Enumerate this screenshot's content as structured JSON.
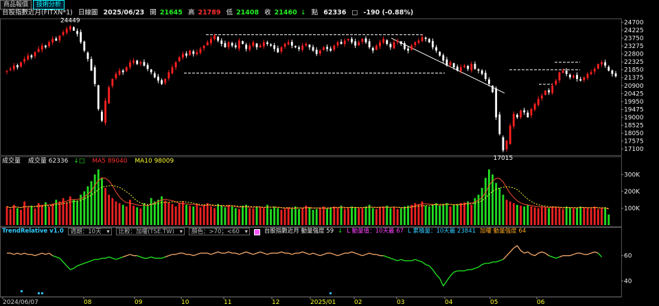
{
  "tabs": [
    {
      "label": "商品報價",
      "active": false
    },
    {
      "label": "技術分析",
      "active": true
    }
  ],
  "header": {
    "symbol": "台股指數近月(FITXN*1)",
    "period": "日線圖",
    "date": "2025/06/23",
    "open_label": "開",
    "open": "21645",
    "high_label": "高",
    "high": "21789",
    "low_label": "低",
    "low": "21408",
    "close": "21460",
    "down_arrow": "↓",
    "close_unit": "點",
    "volume": "62336",
    "box": "□",
    "change": "-190 (-0.88%)"
  },
  "volume_legend": {
    "title": "成交量",
    "vol_label": "成交量 62336",
    "ma5_label": "MA5 89040",
    "ma10_label": "MA10 98009",
    "marks": "↓□"
  },
  "indicator_legend": {
    "name": "TrendRelative v1.0",
    "period_sel": "週期：10天",
    "compare_sel": "比較：加權(TSE.TW)",
    "color_sel": "顏色：>70；<60",
    "ref_label": "台股指數近月 動量強度 59",
    "ref_mark": "↓",
    "l_momentum": "L 動量值：10天最 67",
    "l_accum": "L 累積量：10天最 23841",
    "weighted_mom": "加權 動量強度 64"
  },
  "colors": {
    "up": "#ff2020",
    "down": "#ffffff",
    "vol_up": "#ee2222",
    "vol_down": "#22dd22",
    "ma": "#ffb060",
    "ma10": "#ffff33",
    "trend_up": "#ffb070",
    "trend_down": "#22ee22"
  },
  "chart_data": [
    {
      "type": "candlestick",
      "title": "台股指數近月(FITXN*1) 日線圖",
      "x_tick_labels": [
        "2024/06/07",
        "08",
        "09",
        "10",
        "11",
        "12",
        "2025/01",
        "02",
        "03",
        "04",
        "05",
        "06"
      ],
      "y_tick_labels": [
        "24700",
        "24225",
        "23750",
        "23275",
        "22800",
        "22325",
        "21850",
        "21375",
        "20900",
        "20425",
        "19950",
        "19475",
        "19000",
        "18525",
        "18050",
        "17575",
        "17100"
      ],
      "ylim": [
        16900,
        24800
      ],
      "annotations": [
        {
          "text": "24449",
          "value": 24449
        },
        {
          "text": "17015",
          "value": 17015
        }
      ],
      "trendlines": [
        {
          "from": [
            "2024/11",
            "23950"
          ],
          "to": [
            "2025/03",
            "23950"
          ],
          "style": "dashed"
        },
        {
          "from": [
            "2024/10",
            "21650"
          ],
          "to": [
            "2025/04",
            "21650"
          ],
          "style": "dashed"
        },
        {
          "from": [
            "2025/03",
            "23750"
          ],
          "to": [
            "2025/05",
            "20450"
          ],
          "style": "solid"
        },
        {
          "from": [
            "2025/05",
            "21850"
          ],
          "to": [
            "2025/06",
            "21850"
          ],
          "style": "dashed"
        },
        {
          "from": [
            "2025/06",
            "20980"
          ],
          "to": [
            "2025/06",
            "20980"
          ],
          "style": "dashed"
        },
        {
          "from": [
            "2025/06",
            "22300"
          ],
          "to": [
            "2025/06",
            "22300"
          ],
          "style": "dashed"
        }
      ],
      "closes": [
        21800,
        21900,
        22100,
        22000,
        22300,
        22500,
        22700,
        22600,
        22900,
        23100,
        23300,
        23200,
        23500,
        23700,
        23600,
        23900,
        24100,
        24300,
        24449,
        24200,
        24000,
        23500,
        23000,
        22500,
        21800,
        21000,
        19500,
        18800,
        20000,
        20800,
        21300,
        21600,
        21800,
        21700,
        22000,
        22300,
        22400,
        22200,
        22300,
        22100,
        21900,
        21700,
        21400,
        21200,
        21000,
        21300,
        21700,
        22000,
        22300,
        22600,
        22800,
        22700,
        23000,
        22800,
        22900,
        23100,
        23300,
        23500,
        23700,
        23900,
        23600,
        23400,
        23200,
        23500,
        23300,
        23200,
        23600,
        23400,
        23100,
        23300,
        23500,
        23200,
        23300,
        23500,
        23400,
        23300,
        23100,
        22900,
        23200,
        23400,
        23500,
        23300,
        23200,
        23100,
        23300,
        23400,
        23200,
        23000,
        22800,
        23000,
        23200,
        23100,
        23000,
        23300,
        23500,
        23400,
        23600,
        23700,
        23500,
        23300,
        23500,
        23700,
        23500,
        23200,
        23000,
        23300,
        23500,
        23700,
        23400,
        23200,
        23500,
        23600,
        23400,
        23100,
        23000,
        23300,
        23500,
        23600,
        23800,
        23700,
        23500,
        23200,
        23000,
        22700,
        22400,
        22100,
        22300,
        22000,
        21800,
        22000,
        22100,
        21900,
        22200,
        21900,
        21800,
        21600,
        21300,
        21000,
        20500,
        19000,
        18000,
        17015,
        17600,
        18500,
        19200,
        19000,
        19400,
        19300,
        19000,
        19500,
        19800,
        20100,
        20300,
        20600,
        20500,
        20900,
        21200,
        21700,
        21800,
        21600,
        21400,
        21500,
        21300,
        21200,
        21400,
        21600,
        21700,
        21900,
        22200,
        22300,
        22100,
        21800,
        21600,
        21460
      ]
    },
    {
      "type": "bar",
      "title": "成交量",
      "y_tick_labels": [
        "300K",
        "200K",
        "100K"
      ],
      "ylim": [
        0,
        350000
      ],
      "series": [
        {
          "name": "成交量",
          "last": 62336
        },
        {
          "name": "MA5",
          "last": 89040
        },
        {
          "name": "MA10",
          "last": 98009
        }
      ],
      "values": [
        110000,
        95000,
        120000,
        100000,
        90000,
        140000,
        105000,
        115000,
        98000,
        130000,
        120000,
        135000,
        110000,
        125000,
        150000,
        140000,
        160000,
        135000,
        170000,
        150000,
        145000,
        180000,
        200000,
        230000,
        260000,
        300000,
        330000,
        280000,
        220000,
        180000,
        160000,
        140000,
        130000,
        120000,
        110000,
        150000,
        115000,
        105000,
        98000,
        130000,
        120000,
        160000,
        140000,
        150000,
        170000,
        145000,
        135000,
        125000,
        110000,
        130000,
        140000,
        120000,
        115000,
        110000,
        125000,
        105000,
        120000,
        130000,
        110000,
        100000,
        125000,
        115000,
        105000,
        120000,
        110000,
        100000,
        95000,
        115000,
        120000,
        100000,
        98000,
        110000,
        105000,
        100000,
        120000,
        95000,
        110000,
        100000,
        90000,
        95000,
        105000,
        100000,
        110000,
        95000,
        100000,
        115000,
        105000,
        90000,
        95000,
        100000,
        110000,
        98000,
        105000,
        110000,
        100000,
        115000,
        95000,
        100000,
        110000,
        105000,
        98000,
        100000,
        110000,
        120000,
        100000,
        95000,
        105000,
        110000,
        115000,
        100000,
        105000,
        95000,
        100000,
        110000,
        115000,
        120000,
        130000,
        125000,
        140000,
        115000,
        110000,
        120000,
        130000,
        115000,
        125000,
        130000,
        110000,
        120000,
        125000,
        130000,
        135000,
        140000,
        120000,
        160000,
        180000,
        220000,
        280000,
        330000,
        300000,
        250000,
        220000,
        180000,
        150000,
        140000,
        130000,
        120000,
        115000,
        110000,
        120000,
        110000,
        105000,
        100000,
        110000,
        105000,
        100000,
        110000,
        105000,
        100000,
        95000,
        110000,
        105000,
        98000,
        100000,
        110000,
        105000,
        100000,
        98000,
        110000,
        95000,
        100000,
        105000,
        62336
      ]
    },
    {
      "type": "line",
      "title": "TrendRelative v1.0",
      "y_tick_labels": [
        "60",
        "40"
      ],
      "ylim": [
        30,
        75
      ],
      "values": [
        62,
        62,
        61,
        62,
        61,
        62,
        61,
        61,
        60,
        61,
        62,
        61,
        62,
        60,
        59,
        58,
        55,
        52,
        49,
        50,
        52,
        53,
        54,
        55,
        56,
        57,
        57,
        58,
        58,
        59,
        58,
        57,
        58,
        59,
        60,
        61,
        60,
        60,
        59,
        58,
        58,
        59,
        58,
        58,
        58,
        59,
        60,
        61,
        61,
        62,
        62,
        61,
        61,
        60,
        61,
        62,
        62,
        62,
        61,
        62,
        63,
        62,
        62,
        63,
        62,
        62,
        61,
        62,
        63,
        62,
        61,
        62,
        63,
        62,
        61,
        62,
        62,
        62,
        63,
        62,
        62,
        61,
        62,
        62,
        63,
        62,
        61,
        62,
        61,
        60,
        61,
        62,
        62,
        61,
        60,
        61,
        62,
        62,
        63,
        62,
        61,
        60,
        61,
        62,
        61,
        61,
        60,
        60,
        59,
        58,
        57,
        56,
        57,
        56,
        56,
        56,
        57,
        56,
        55,
        53,
        52,
        49,
        45,
        42,
        36,
        40,
        44,
        47,
        48,
        48,
        48,
        49,
        49,
        50,
        51,
        53,
        54,
        54,
        55,
        55,
        56,
        57,
        60,
        63,
        66,
        68,
        64,
        62,
        63,
        61,
        60,
        62,
        63,
        62,
        60,
        59,
        58,
        59,
        60,
        60,
        60,
        61,
        62,
        62,
        61,
        61,
        62,
        63,
        62,
        59
      ]
    }
  ]
}
